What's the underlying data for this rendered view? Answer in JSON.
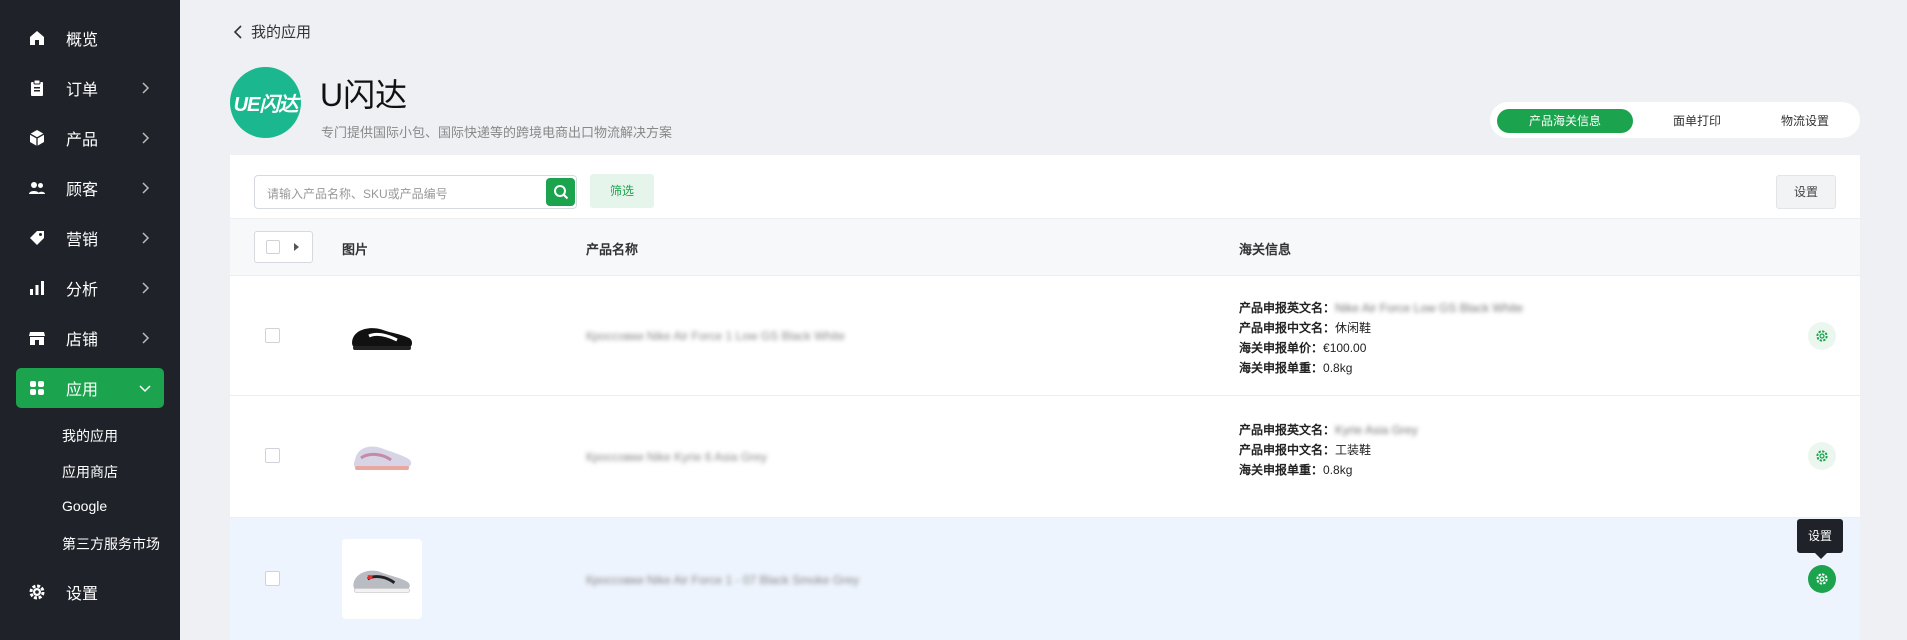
{
  "sidebar": {
    "items": [
      {
        "label": "概览",
        "icon": "home-icon"
      },
      {
        "label": "订单",
        "icon": "clipboard-icon"
      },
      {
        "label": "产品",
        "icon": "box-icon"
      },
      {
        "label": "顾客",
        "icon": "users-icon"
      },
      {
        "label": "营销",
        "icon": "tag-icon"
      },
      {
        "label": "分析",
        "icon": "bar-chart-icon"
      },
      {
        "label": "店铺",
        "icon": "store-icon"
      },
      {
        "label": "应用",
        "icon": "apps-icon"
      }
    ],
    "sub_items": [
      "我的应用",
      "应用商店",
      "Google",
      "第三方服务市场"
    ],
    "settings": {
      "label": "设置",
      "icon": "gear-icon"
    },
    "accent_color": "#1ba34d"
  },
  "breadcrumb": {
    "back_label": "我的应用"
  },
  "app": {
    "logo_text": "UE闪达",
    "title": "U闪达",
    "description": "专门提供国际小包、国际快递等的跨境电商出口物流解决方案"
  },
  "tabs": [
    {
      "label": "产品海关信息",
      "active": true
    },
    {
      "label": "面单打印",
      "active": false
    },
    {
      "label": "物流设置",
      "active": false
    }
  ],
  "toolbar": {
    "search_placeholder": "请输入产品名称、SKU或产品编号",
    "filter_label": "筛选",
    "settings_label": "设置"
  },
  "table": {
    "headers": {
      "image": "图片",
      "name": "产品名称",
      "customs": "海关信息"
    },
    "rows": [
      {
        "name": "Кроссовки Nike Air Force 1 Low GS Black White",
        "customs": [
          {
            "label": "产品申报英文名：",
            "value": "Nike Air Force Low GS Black White",
            "blurred": true
          },
          {
            "label": "产品申报中文名：",
            "value": "休闲鞋",
            "blurred": false
          },
          {
            "label": "海关申报单价：",
            "value": "€100.00",
            "blurred": false
          },
          {
            "label": "海关申报单重：",
            "value": "0.8kg",
            "blurred": false
          }
        ]
      },
      {
        "name": "Кроссовки Nike Kyrie 6 Asia Grey",
        "customs": [
          {
            "label": "产品申报英文名：",
            "value": "Kyrie Asia Grey",
            "blurred": true
          },
          {
            "label": "产品申报中文名：",
            "value": "工装鞋",
            "blurred": false
          },
          {
            "label": "海关申报单重：",
            "value": "0.8kg",
            "blurred": false
          }
        ]
      },
      {
        "name": "Кроссовки Nike Air Force 1 - 07 Black Smoke Grey",
        "customs": []
      }
    ]
  },
  "tooltip": {
    "label": "设置"
  }
}
